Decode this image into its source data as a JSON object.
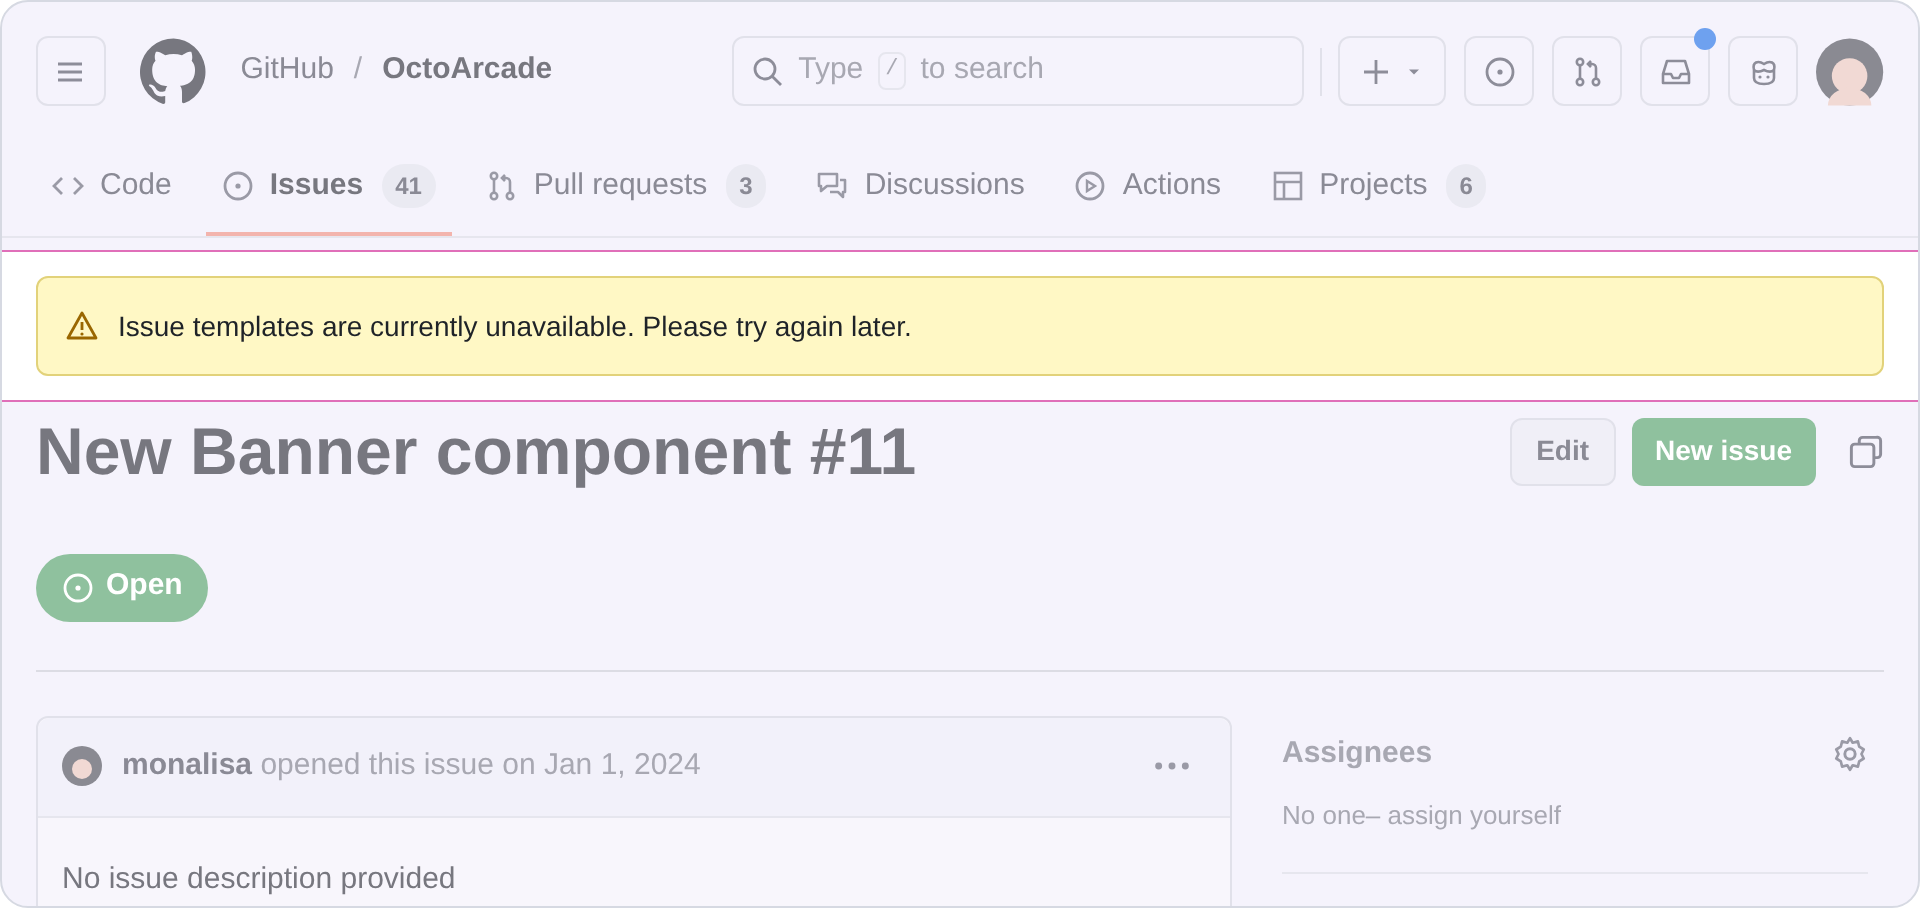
{
  "header": {
    "owner": "GitHub",
    "separator": "/",
    "repo": "OctoArcade",
    "search": {
      "text": "Type",
      "key": "/",
      "hint": "to search"
    },
    "inbox_unread": true
  },
  "tabs": [
    {
      "label": "Code",
      "kind": "code",
      "selected": false
    },
    {
      "label": "Issues",
      "kind": "issue",
      "counter": "41",
      "selected": true
    },
    {
      "label": "Pull requests",
      "kind": "pull",
      "counter": "3",
      "selected": false
    },
    {
      "label": "Discussions",
      "kind": "discussion",
      "selected": false
    },
    {
      "label": "Actions",
      "kind": "play",
      "selected": false
    },
    {
      "label": "Projects",
      "kind": "table",
      "counter": "6",
      "selected": false
    }
  ],
  "banner": {
    "message": "Issue templates are currently unavailable. Please try again later."
  },
  "issue": {
    "title": "New Banner component #11",
    "buttons": [
      "Edit",
      "New issue"
    ],
    "state": "Open"
  },
  "comment": {
    "author": "monalisa",
    "action": "opened this issue on Jan 1, 2024",
    "body": "No issue description provided"
  },
  "sidebar": {
    "heading": "Assignees",
    "text": "No one– assign yourself"
  }
}
